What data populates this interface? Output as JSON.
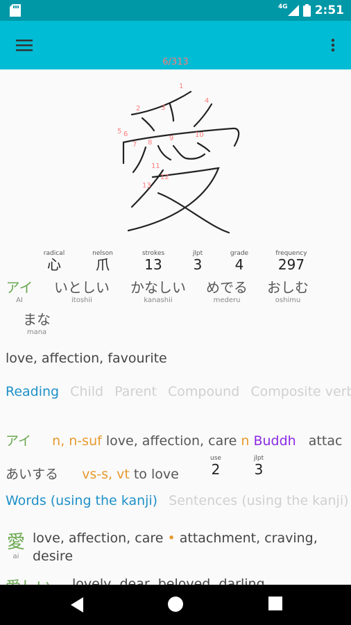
{
  "status_bar": {
    "time": "2:51",
    "network": "4G"
  },
  "app_bar": {
    "counter": "6/313"
  },
  "kanji": {
    "character": "愛",
    "stroke_numbers": [
      "1",
      "2",
      "3",
      "4",
      "5",
      "6",
      "7",
      "8",
      "9",
      "10",
      "11",
      "12",
      "13"
    ],
    "attributes": [
      {
        "label": "radical",
        "value": "心"
      },
      {
        "label": "nelson",
        "value": "爪"
      },
      {
        "label": "strokes",
        "value": "13"
      },
      {
        "label": "jlpt",
        "value": "3"
      },
      {
        "label": "grade",
        "value": "4"
      },
      {
        "label": "frequency",
        "value": "297"
      }
    ],
    "readings": [
      {
        "kana": "アイ",
        "romaji": "AI"
      },
      {
        "kana": "いとしい",
        "romaji": "itoshii"
      },
      {
        "kana": "かなしい",
        "romaji": "kanashii"
      },
      {
        "kana": "めでる",
        "romaji": "mederu"
      },
      {
        "kana": "おしむ",
        "romaji": "oshimu"
      },
      {
        "kana": "まな",
        "romaji": "mana"
      }
    ],
    "meaning": "love, affection, favourite"
  },
  "tabs1": [
    "Reading",
    "Child",
    "Parent",
    "Compound",
    "Composite verb"
  ],
  "reading_entries": [
    {
      "kana": "アイ",
      "pos": "n, n-suf",
      "meaning": "love, affection, care",
      "pos2": "n",
      "domain": "Buddh",
      "meaning2": "attac"
    },
    {
      "kana": "あいする",
      "pos": "vs-s, vt",
      "meaning": "to love",
      "ranks": [
        {
          "label": "use",
          "value": "2"
        },
        {
          "label": "jlpt",
          "value": "3"
        }
      ]
    }
  ],
  "tabs2": [
    "Words (using the kanji)",
    "Sentences (using the kanji)"
  ],
  "words": [
    {
      "kanji": "愛",
      "reading": "ai",
      "meaning": "love, affection, care",
      "separator": "•",
      "meaning2": "attachment, craving, desire"
    },
    {
      "kanji": "愛しい",
      "reading": "",
      "meaning": "lovely, dear, beloved, darling",
      "separator": "",
      "meaning2": ""
    }
  ]
}
